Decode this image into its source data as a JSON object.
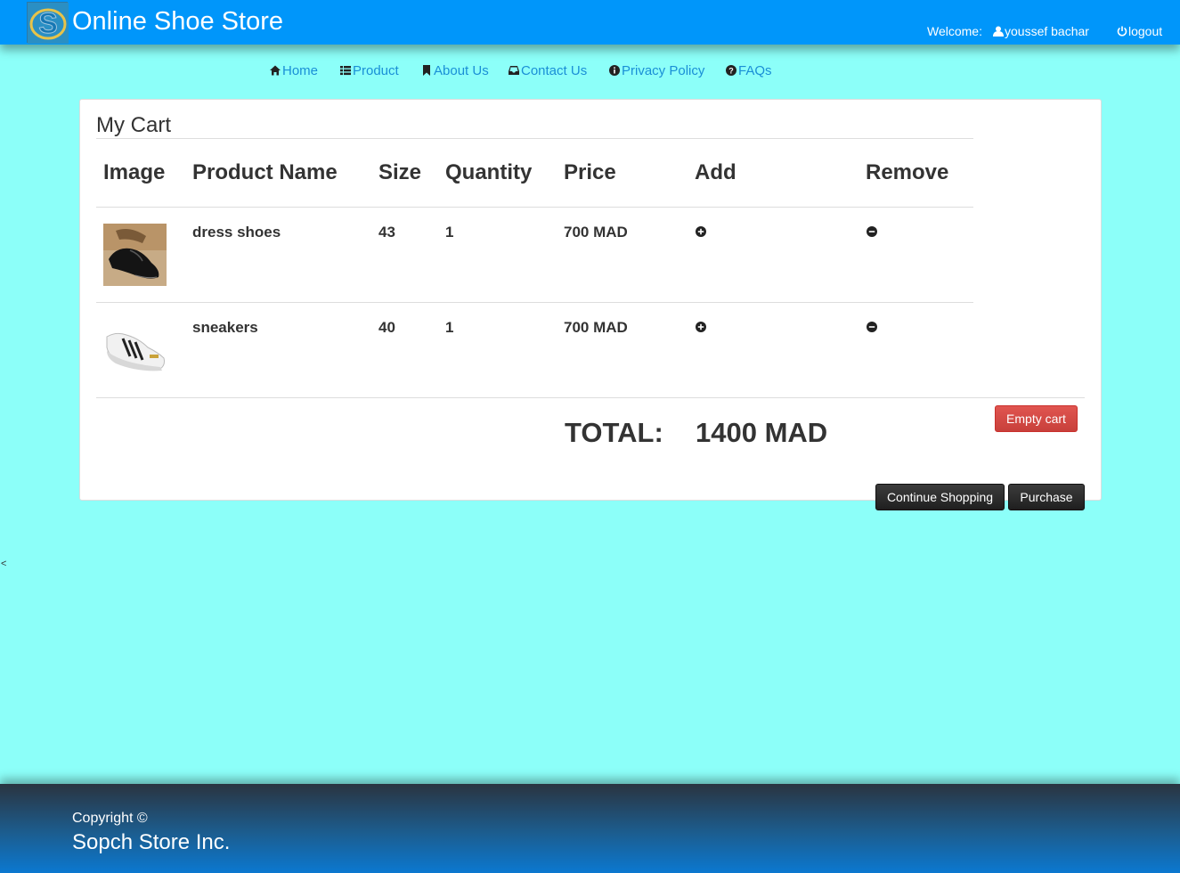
{
  "header": {
    "brand": "Online Shoe Store",
    "welcome_label": "Welcome:",
    "user_name": "youssef bachar",
    "logout_label": "logout",
    "brand_color": "#0096fa"
  },
  "nav": {
    "items": [
      {
        "label": "Home",
        "icon": "home-icon"
      },
      {
        "label": "Product",
        "icon": "list-icon"
      },
      {
        "label": "About Us",
        "icon": "bookmark-icon"
      },
      {
        "label": "Contact Us",
        "icon": "inbox-icon"
      },
      {
        "label": "Privacy Policy",
        "icon": "info-icon"
      },
      {
        "label": "FAQs",
        "icon": "question-icon"
      }
    ]
  },
  "cart": {
    "title": "My Cart",
    "columns": [
      "Image",
      "Product Name",
      "Size",
      "Quantity",
      "Price",
      "Add",
      "Remove"
    ],
    "rows": [
      {
        "name": "dress shoes",
        "size": "43",
        "quantity": "1",
        "price": "700 MAD",
        "image": "dress-shoe-image"
      },
      {
        "name": "sneakers",
        "size": "40",
        "quantity": "1",
        "price": "700 MAD",
        "image": "sneaker-image"
      }
    ],
    "total_label": "TOTAL:",
    "total_value": "1400 MAD",
    "empty_cart_label": "Empty cart",
    "continue_label": "Continue Shopping",
    "purchase_label": "Purchase",
    "empty_color": "#d9534f"
  },
  "stray_text": "<",
  "footer": {
    "copyright": "Copyright ©",
    "company": "Sopch Store Inc."
  }
}
